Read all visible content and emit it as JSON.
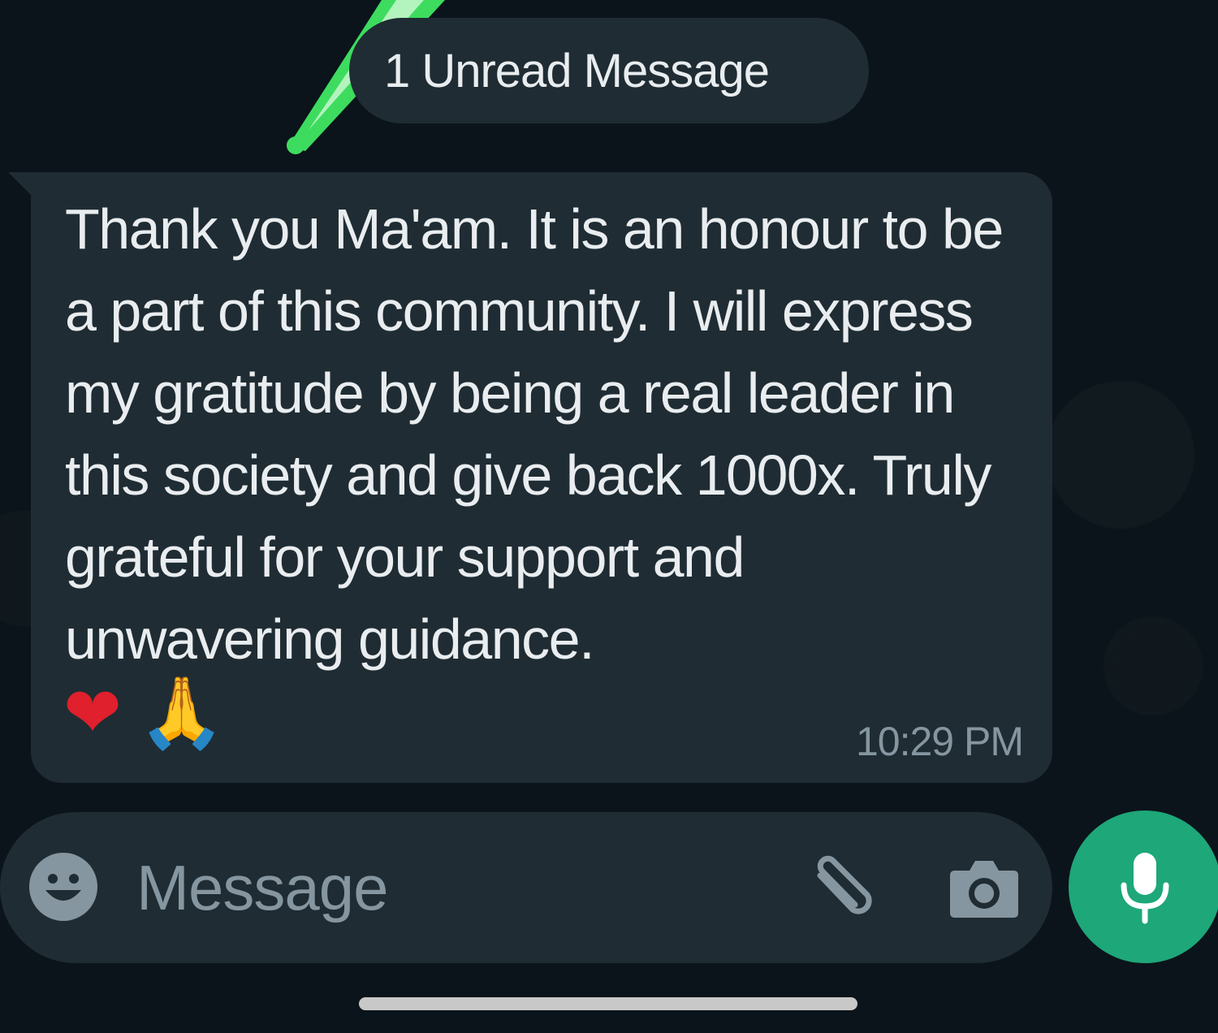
{
  "chat": {
    "unread_banner": "1 Unread Message",
    "messages": [
      {
        "text": "Thank you Ma'am. It is an honour to be a part of this community. I will express my gratitude by being a real leader in this society and give back 1000x. Truly grateful for your support and unwavering guidance.",
        "emojis": [
          "❤",
          "🙏"
        ],
        "time": "10:29 PM"
      }
    ]
  },
  "composer": {
    "placeholder": "Message",
    "icons": {
      "emoji": "emoji-icon",
      "attach": "paperclip-icon",
      "camera": "camera-icon",
      "mic": "mic-icon"
    }
  },
  "colors": {
    "background": "#0b141a",
    "bubble": "#1f2c33",
    "text": "#e9edef",
    "muted": "#8696a0",
    "accent": "#1ea779",
    "annotation_arrow": "#3ddc5f"
  }
}
